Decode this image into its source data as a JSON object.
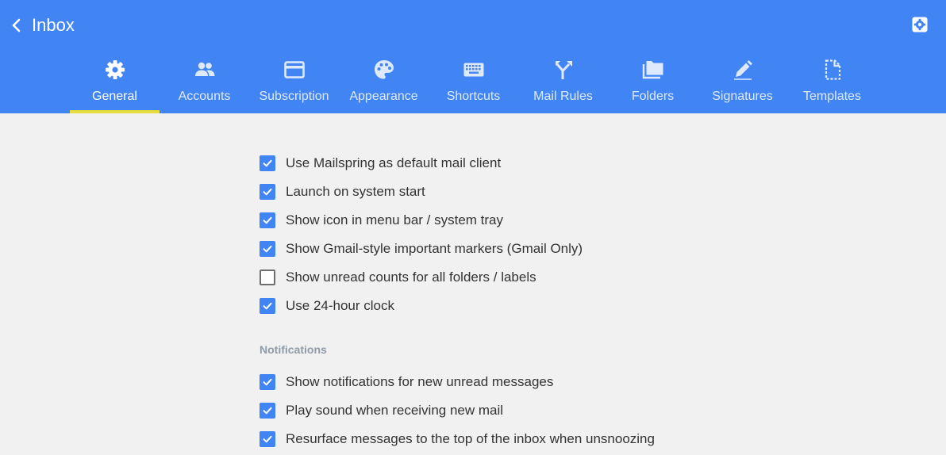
{
  "header": {
    "back_label": "Inbox",
    "bg_color": "#4185f4",
    "active_underline_color": "#e7dd3e",
    "tabs": [
      {
        "label": "General",
        "icon": "gear-icon",
        "active": true
      },
      {
        "label": "Accounts",
        "icon": "people-icon",
        "active": false
      },
      {
        "label": "Subscription",
        "icon": "credit-card-icon",
        "active": false
      },
      {
        "label": "Appearance",
        "icon": "palette-icon",
        "active": false
      },
      {
        "label": "Shortcuts",
        "icon": "keyboard-icon",
        "active": false
      },
      {
        "label": "Mail Rules",
        "icon": "fork-arrow-icon",
        "active": false
      },
      {
        "label": "Folders",
        "icon": "folders-icon",
        "active": false
      },
      {
        "label": "Signatures",
        "icon": "pen-icon",
        "active": false
      },
      {
        "label": "Templates",
        "icon": "template-icon",
        "active": false
      }
    ]
  },
  "general": {
    "options": [
      {
        "label": "Use Mailspring as default mail client",
        "checked": true
      },
      {
        "label": "Launch on system start",
        "checked": true
      },
      {
        "label": "Show icon in menu bar / system tray",
        "checked": true
      },
      {
        "label": "Show Gmail-style important markers (Gmail Only)",
        "checked": true
      },
      {
        "label": "Show unread counts for all folders / labels",
        "checked": false
      },
      {
        "label": "Use 24-hour clock",
        "checked": true
      }
    ]
  },
  "notifications": {
    "title": "Notifications",
    "options": [
      {
        "label": "Show notifications for new unread messages",
        "checked": true
      },
      {
        "label": "Play sound when receiving new mail",
        "checked": true
      },
      {
        "label": "Resurface messages to the top of the inbox when unsnoozing",
        "checked": true
      }
    ]
  }
}
